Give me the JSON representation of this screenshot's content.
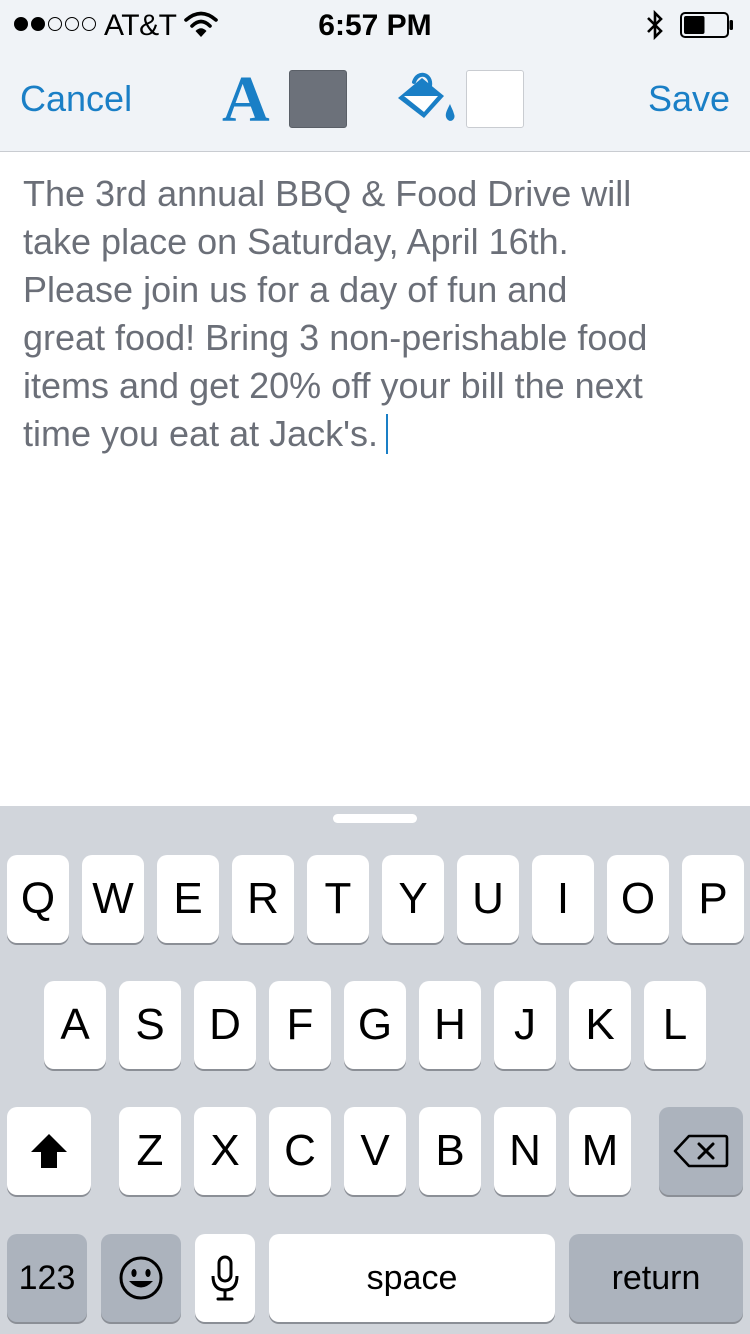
{
  "status_bar": {
    "carrier": "AT&T",
    "time": "6:57 PM",
    "signal_bars_filled": 2,
    "signal_bars_total": 5,
    "battery_level": 0.5
  },
  "toolbar": {
    "cancel_label": "Cancel",
    "font_label": "A",
    "text_color": "#6c717a",
    "background_color": "#ffffff",
    "fill_icon": "paint-bucket-icon",
    "save_label": "Save",
    "accent_color": "#1a7fc6"
  },
  "editor": {
    "text": "The 3rd annual BBQ & Food Drive will\ntake place on Saturday, April 16th.\nPlease join us for a day of fun and\ngreat food! Bring 3 non-perishable food\nitems and get 20% off your bill the next\ntime you eat at Jack's."
  },
  "keyboard": {
    "row1": [
      "Q",
      "W",
      "E",
      "R",
      "T",
      "Y",
      "U",
      "I",
      "O",
      "P"
    ],
    "row2": [
      "A",
      "S",
      "D",
      "F",
      "G",
      "H",
      "J",
      "K",
      "L"
    ],
    "row3": [
      "Z",
      "X",
      "C",
      "V",
      "B",
      "N",
      "M"
    ],
    "shift_icon": "shift-arrow-icon",
    "delete_icon": "backspace-icon",
    "numbers_label": "123",
    "emoji_icon": "emoji-icon",
    "mic_icon": "microphone-icon",
    "space_label": "space",
    "return_label": "return"
  }
}
